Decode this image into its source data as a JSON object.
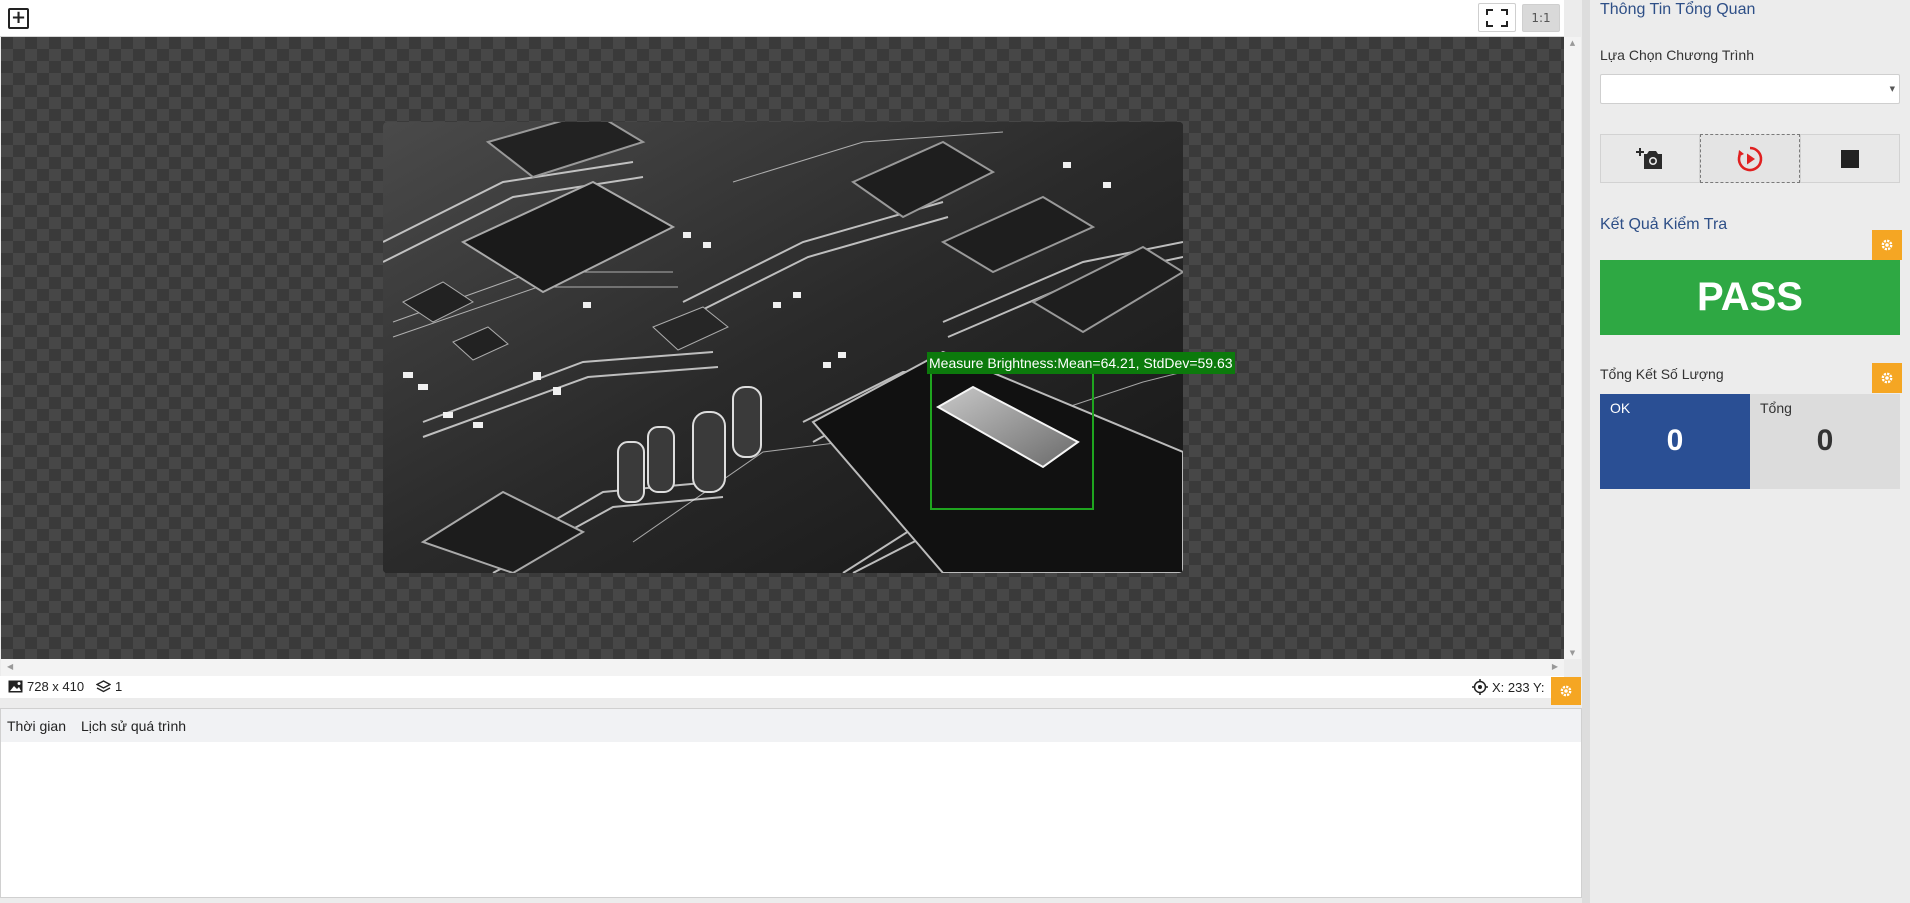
{
  "viewer": {
    "add_icon": "plus-square-icon",
    "fit_icon": "fullscreen-icon",
    "zoom_label": "1:1",
    "roi_label": "Measure Brightness:Mean=64.21, StdDev=59.63",
    "roi_color": "#1fa51f"
  },
  "status": {
    "image_size": "728 x 410",
    "layer_count": "1",
    "coords": "X: 233 Y:"
  },
  "history": {
    "col_time": "Thời gian",
    "col_history": "Lịch sử quá trình"
  },
  "panel": {
    "overview_title": "Thông Tin Tổng Quan",
    "program_label": "Lựa Chọn Chương Trình",
    "program_value": "",
    "controls": [
      "camera-add-icon",
      "play-circle-icon",
      "stop-icon"
    ],
    "result_title": "Kết Quả Kiểm Tra",
    "result_value": "PASS",
    "result_color": "#2ea843",
    "summary_title": "Tổng Kết Số Lượng",
    "ok_label": "OK",
    "ok_value": "0",
    "total_label": "Tổng",
    "total_value": "0",
    "accent_color": "#f5a623"
  }
}
